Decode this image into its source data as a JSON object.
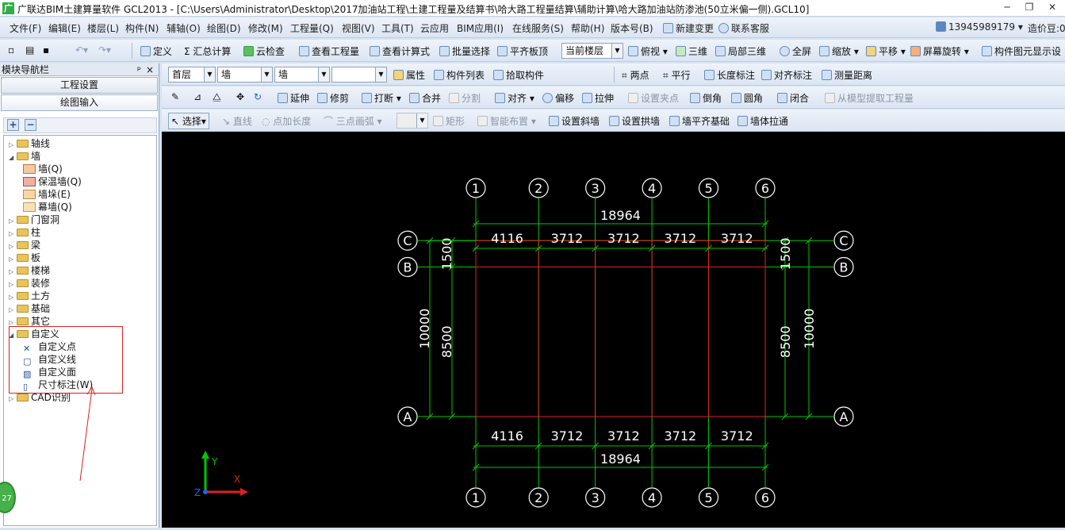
{
  "window": {
    "app_icon": "广",
    "title": "广联达BIM土建算量软件 GCL2013 - [C:\\Users\\Administrator\\Desktop\\2017加油站工程\\土建工程量及结算书\\哈大路工程量结算\\辅助计算\\哈大路加油站防渗池(50立米偏一侧).GCL10]",
    "minimize": "─",
    "restore": "❐",
    "close": "✕"
  },
  "menu": [
    "文件(F)",
    "编辑(E)",
    "楼层(L)",
    "构件(N)",
    "辅轴(O)",
    "绘图(D)",
    "修改(M)",
    "工程量(Q)",
    "视图(V)",
    "工具(T)",
    "云应用",
    "BIM应用(I)",
    "在线服务(S)",
    "帮助(H)",
    "版本号(B)"
  ],
  "menu_right": {
    "new_change": "新建变更",
    "support": "联系客服",
    "account": "13945989179",
    "account_arrow": "▾",
    "beans": "造价豆:0"
  },
  "toolbar1": {
    "define": "定义",
    "sum_calc": "汇总计算",
    "cloud_check": "云检查",
    "view_qty": "查看工程量",
    "view_formula": "查看计算式",
    "batch_select": "批量选择",
    "flush_slab": "平齐板顶",
    "floor_scope": "当前楼层",
    "top_view": "俯视",
    "three_d": "三维",
    "local_3d": "局部三维",
    "full_screen": "全屏",
    "zoom": "缩放",
    "pan": "平移",
    "rotate": "屏幕旋转",
    "display_settings": "构件图元显示设"
  },
  "toolbar2": {
    "floor": "首层",
    "category": "墙",
    "component": "墙",
    "blank": "",
    "properties": "属性",
    "component_list": "构件列表",
    "pick_component": "拾取构件",
    "two_points": "两点",
    "parallel": "平行",
    "length_dim": "长度标注",
    "aligned_dim": "对齐标注",
    "measure": "测量距离"
  },
  "toolbar3": {
    "extend": "延伸",
    "trim": "修剪",
    "break": "打断",
    "merge": "合并",
    "split": "分割",
    "align": "对齐",
    "offset": "偏移",
    "stretch": "拉伸",
    "set_clip": "设置夹点",
    "chamfer": "倒角",
    "fillet": "圆角",
    "close": "闭合",
    "extract_model": "从模型提取工程量"
  },
  "toolbar4": {
    "select": "选择",
    "line": "直线",
    "point_length": "点加长度",
    "three_point_arc": "三点画弧",
    "rect": "矩形",
    "smart_layout": "智能布置",
    "set_slope": "设置斜墙",
    "set_arch": "设置拱墙",
    "wall_flush_base": "墙平齐基础",
    "wall_pull": "墙体拉通"
  },
  "nav": {
    "title": "模块导航栏",
    "pin": "ᵖ",
    "close": "×",
    "project_settings": "工程设置",
    "drawing_input": "绘图输入",
    "expand_all": "+",
    "collapse_all": "−",
    "tree": [
      {
        "label": "轴线",
        "level": 0,
        "type": "folder",
        "expanded": false
      },
      {
        "label": "墙",
        "level": 0,
        "type": "folder",
        "expanded": true
      },
      {
        "label": "墙(Q)",
        "level": 1,
        "type": "wall"
      },
      {
        "label": "保温墙(Q)",
        "level": 1,
        "type": "insul"
      },
      {
        "label": "墙垛(E)",
        "level": 1,
        "type": "pier"
      },
      {
        "label": "幕墙(Q)",
        "level": 1,
        "type": "curtain"
      },
      {
        "label": "门窗洞",
        "level": 0,
        "type": "folder",
        "expanded": false
      },
      {
        "label": "柱",
        "level": 0,
        "type": "folder",
        "expanded": false
      },
      {
        "label": "梁",
        "level": 0,
        "type": "folder",
        "expanded": false
      },
      {
        "label": "板",
        "level": 0,
        "type": "folder",
        "expanded": false
      },
      {
        "label": "楼梯",
        "level": 0,
        "type": "folder",
        "expanded": false
      },
      {
        "label": "装修",
        "level": 0,
        "type": "folder",
        "expanded": false
      },
      {
        "label": "土方",
        "level": 0,
        "type": "folder",
        "expanded": false
      },
      {
        "label": "基础",
        "level": 0,
        "type": "folder",
        "expanded": false
      },
      {
        "label": "其它",
        "level": 0,
        "type": "folder",
        "expanded": false
      },
      {
        "label": "自定义",
        "level": 0,
        "type": "folder",
        "expanded": true
      },
      {
        "label": "自定义点",
        "level": 1,
        "type": "cpoint"
      },
      {
        "label": "自定义线",
        "level": 1,
        "type": "cline"
      },
      {
        "label": "自定义面",
        "level": 1,
        "type": "cface"
      },
      {
        "label": "尺寸标注(W)",
        "level": 1,
        "type": "dim"
      },
      {
        "label": "CAD识别",
        "level": 0,
        "type": "folder",
        "expanded": false
      }
    ],
    "badge": "27"
  },
  "drawing": {
    "colors": {
      "grid": "#00c800",
      "wall": "#e02020",
      "bubble": "#ffffff",
      "text": "#ffffff",
      "bg": "#000000"
    },
    "axes_x": [
      "1",
      "2",
      "3",
      "4",
      "5",
      "6"
    ],
    "axes_y": [
      "A",
      "B",
      "C"
    ],
    "total_width": "18964",
    "spans": [
      "4116",
      "3712",
      "3712",
      "3712",
      "3712"
    ],
    "total_depth": "10000",
    "depth_ab": "8500",
    "depth_bc": "1500",
    "ucs": {
      "x": "X",
      "y": "Y",
      "z": "Z"
    }
  }
}
